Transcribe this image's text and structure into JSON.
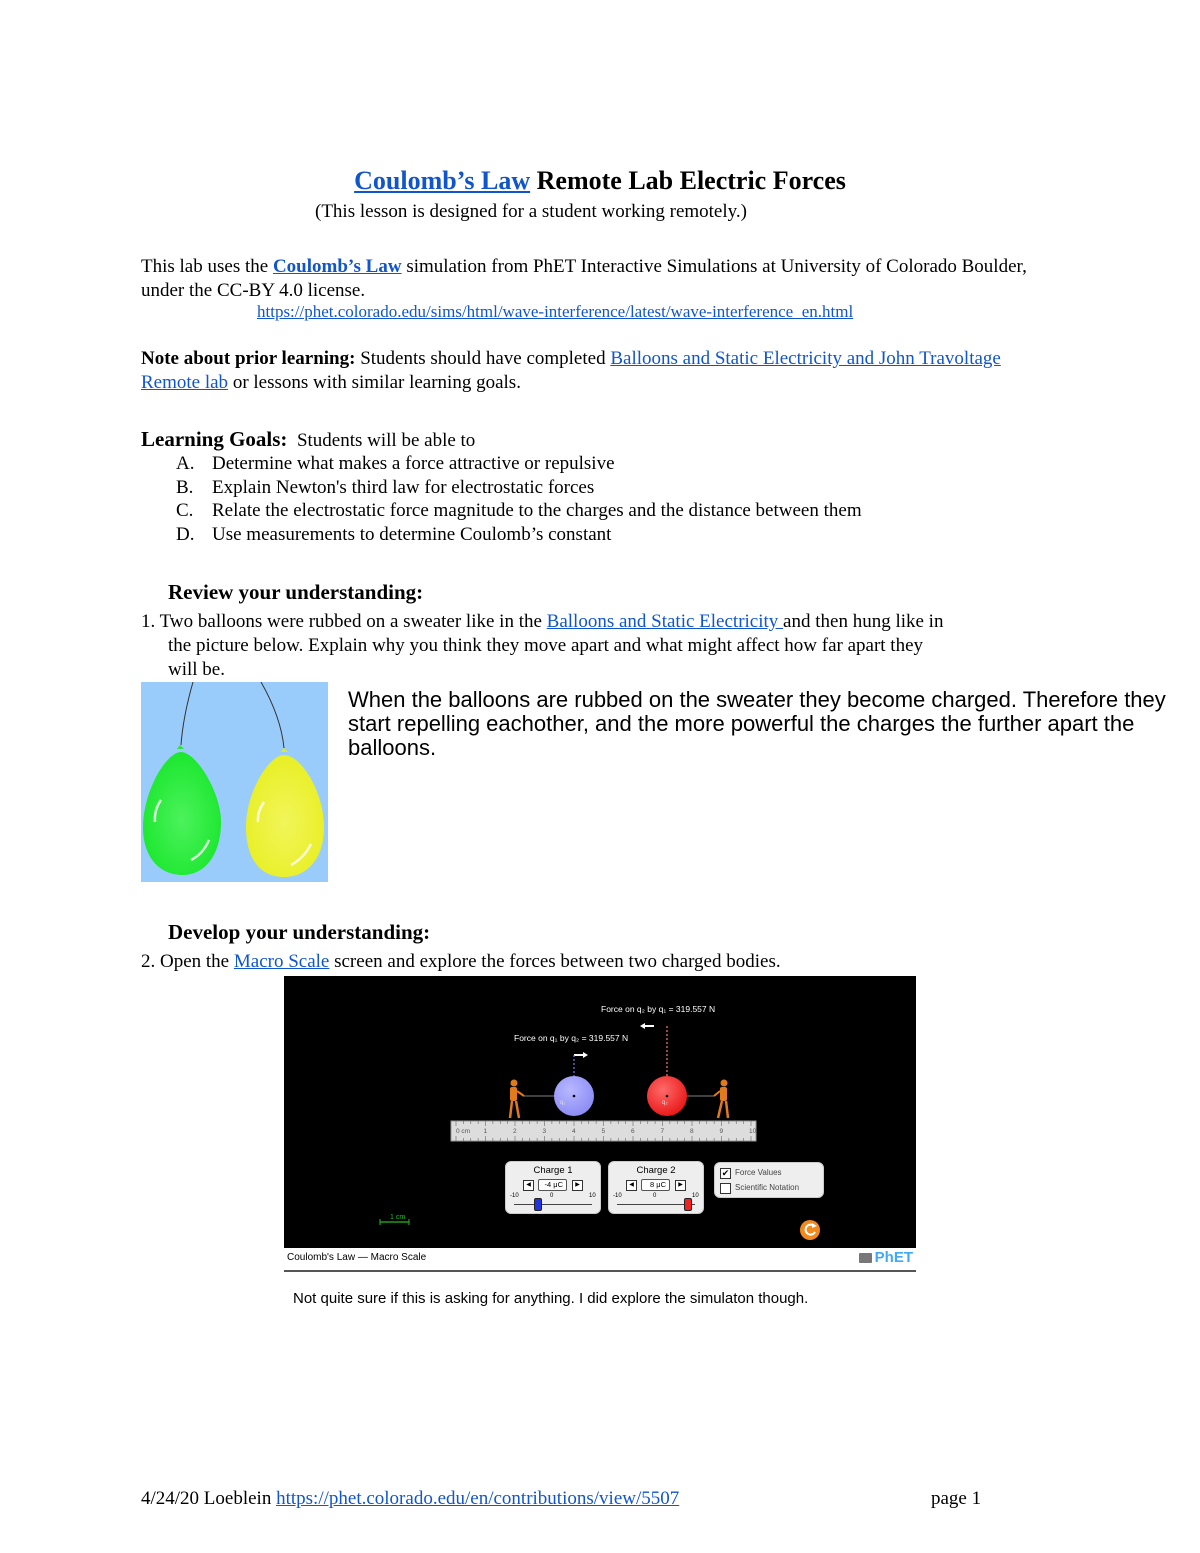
{
  "header": {
    "title_link": "Coulomb’s Law",
    "title_rest": " Remote Lab Electric Forces",
    "subtitle": "(This lesson is designed for a student working remotely.)"
  },
  "intro": {
    "text_before": "This lab uses the ",
    "link": "Coulomb’s Law",
    "text_after": " simulation from PhET Interactive Simulations at University of Colorado Boulder, under the CC-BY 4.0 license.",
    "url": "https://phet.colorado.edu/sims/html/wave-interference/latest/wave-interference_en.html"
  },
  "note": {
    "label": "Note about prior learning:",
    "text_before": " Students should have completed ",
    "link": "Balloons and Static Electricity and John Travoltage Remote lab",
    "text_after": " or lessons with similar learning goals."
  },
  "learning_goals": {
    "label": "Learning Goals:",
    "intro": "Students will be able to",
    "items": [
      {
        "letter": "A.",
        "text": "Determine what makes a force attractive or repulsive"
      },
      {
        "letter": "B.",
        "text": "Explain Newton's third law for electrostatic forces"
      },
      {
        "letter": "C.",
        "text": "Relate the electrostatic force magnitude to the charges and the distance between them"
      },
      {
        "letter": "D.",
        "text": "Use measurements to determine Coulomb’s constant"
      }
    ]
  },
  "review": {
    "heading": "Review your understanding:",
    "q1_number": "1.",
    "q1_before": " Two balloons were rubbed on a sweater like in the ",
    "q1_link": "Balloons and Static Electricity ",
    "q1_after": "and then hung like in",
    "q1_line2": "the picture below. Explain why you think they move apart and what might affect how far apart they",
    "q1_line3": "will be.",
    "answer": "When the balloons are rubbed on the sweater they become charged. Therefore they start repelling eachother, and the more powerful the charges the further apart the balloons."
  },
  "develop": {
    "heading": "Develop your understanding:",
    "q2_number": "2.",
    "q2_before": " Open the ",
    "q2_link": "Macro Scale",
    "q2_after": " screen and explore the forces between two charged bodies.",
    "answer": "Not quite sure if this is asking for anything. I did explore the simulaton though."
  },
  "simulation": {
    "force_on_q2": "Force on q₂ by q₁ = 319.557 N",
    "force_on_q1": "Force on q₁ by q₂ = 319.557 N",
    "q1_label": "q₁",
    "q2_label": "q₂",
    "ruler_labels": [
      "0 cm",
      "1",
      "2",
      "3",
      "4",
      "5",
      "6",
      "7",
      "8",
      "9",
      "10"
    ],
    "q1_position_cm": 4,
    "q2_position_cm": 7,
    "charge1": {
      "title": "Charge 1",
      "value": "-4 μC",
      "min": "-10",
      "zero": "0",
      "max": "10",
      "amount": -4
    },
    "charge2": {
      "title": "Charge 2",
      "value": "8 μC",
      "min": "-10",
      "zero": "0",
      "max": "10",
      "amount": 8
    },
    "checkboxes": [
      {
        "label": "Force Values",
        "checked": true
      },
      {
        "label": "Scientific Notation",
        "checked": false
      }
    ],
    "scale_label": "1 cm",
    "footer_title": "Coulomb's Law — Macro Scale",
    "logo": "PhET",
    "colors": {
      "q1": "#9999ff",
      "q2": "#ff2222",
      "scale": "#22bb22",
      "reset": "#f08a1c",
      "logo": "#3fa9f5"
    }
  },
  "footer": {
    "left": "4/24/20 Loeblein ",
    "link": "https://phet.colorado.edu/en/contributions/view/5507",
    "page": "page 1"
  }
}
